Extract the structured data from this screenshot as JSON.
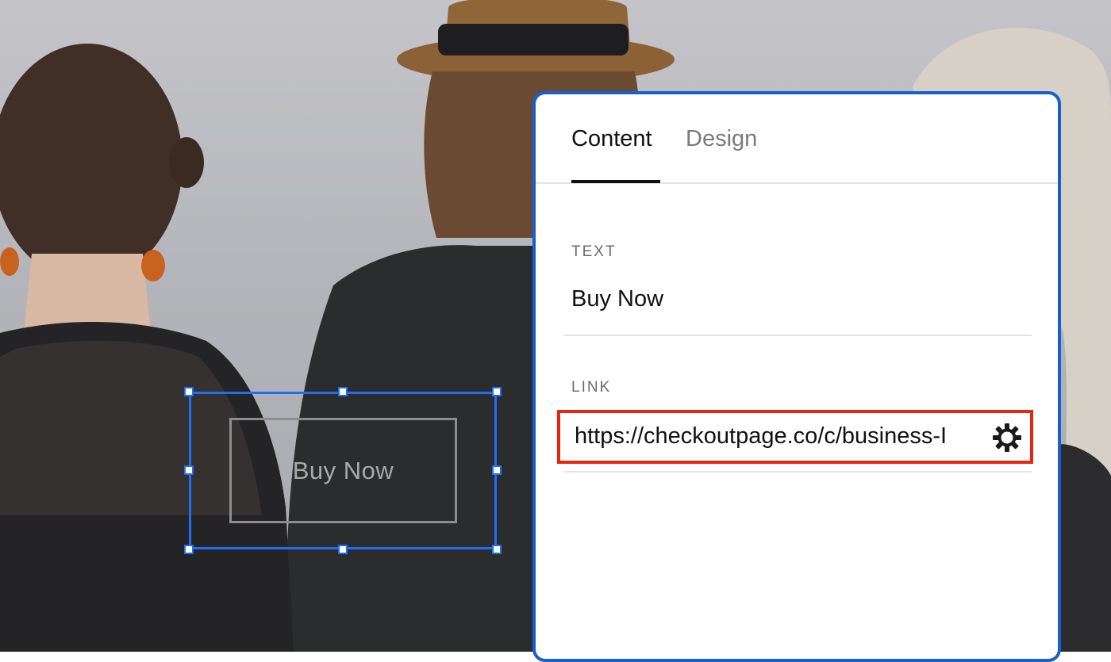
{
  "canvas": {
    "button_label": "Buy Now"
  },
  "panel": {
    "tabs": [
      {
        "label": "Content",
        "active": true
      },
      {
        "label": "Design",
        "active": false
      }
    ],
    "text_field": {
      "label": "TEXT",
      "value": "Buy Now"
    },
    "link_field": {
      "label": "LINK",
      "value": "https://checkoutpage.co/c/business-I",
      "icon": "gear-icon"
    }
  },
  "colors": {
    "selection": "#1f6ff2",
    "panel_border": "#1a5fd0",
    "highlight": "#e6260f"
  }
}
